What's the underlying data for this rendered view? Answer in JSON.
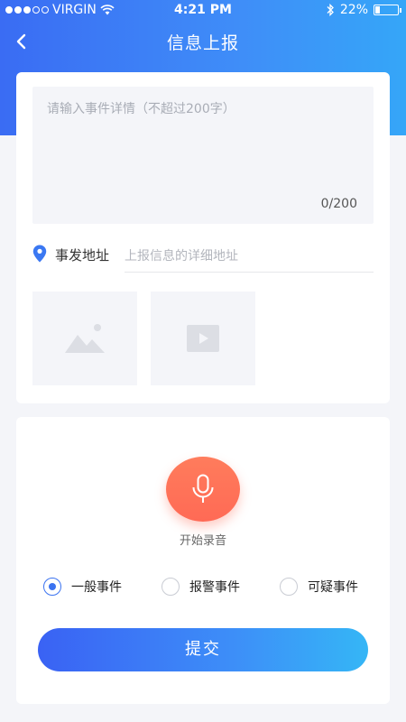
{
  "status_bar": {
    "carrier": "VIRGIN",
    "time": "4:21 PM",
    "battery": "22%",
    "battery_level": 0.22,
    "signal_bars_filled": 3,
    "signal_bars_total": 5,
    "icons": [
      "signal-dots-icon",
      "wifi-icon",
      "bluetooth-icon",
      "battery-icon"
    ]
  },
  "nav": {
    "title": "信息上报",
    "back_icon": "chevron-left-icon"
  },
  "form": {
    "details_placeholder": "请输入事件详情（不超过200字）",
    "char_count": "0/200",
    "address_label": "事发地址",
    "address_placeholder": "上报信息的详细地址",
    "location_icon": "location-pin-icon",
    "media_buttons": [
      "image-placeholder-icon",
      "video-placeholder-icon"
    ]
  },
  "recording": {
    "label": "开始录音",
    "icon": "microphone-icon"
  },
  "event_types": {
    "options": [
      "一般事件",
      "报警事件",
      "可疑事件"
    ],
    "selected": "一般事件"
  },
  "submit_label": "提交",
  "colors": {
    "primary": "#3a6cf3",
    "primary_light": "#35a6f8",
    "record_button": "#ff6a55",
    "background": "#f4f5f9"
  }
}
